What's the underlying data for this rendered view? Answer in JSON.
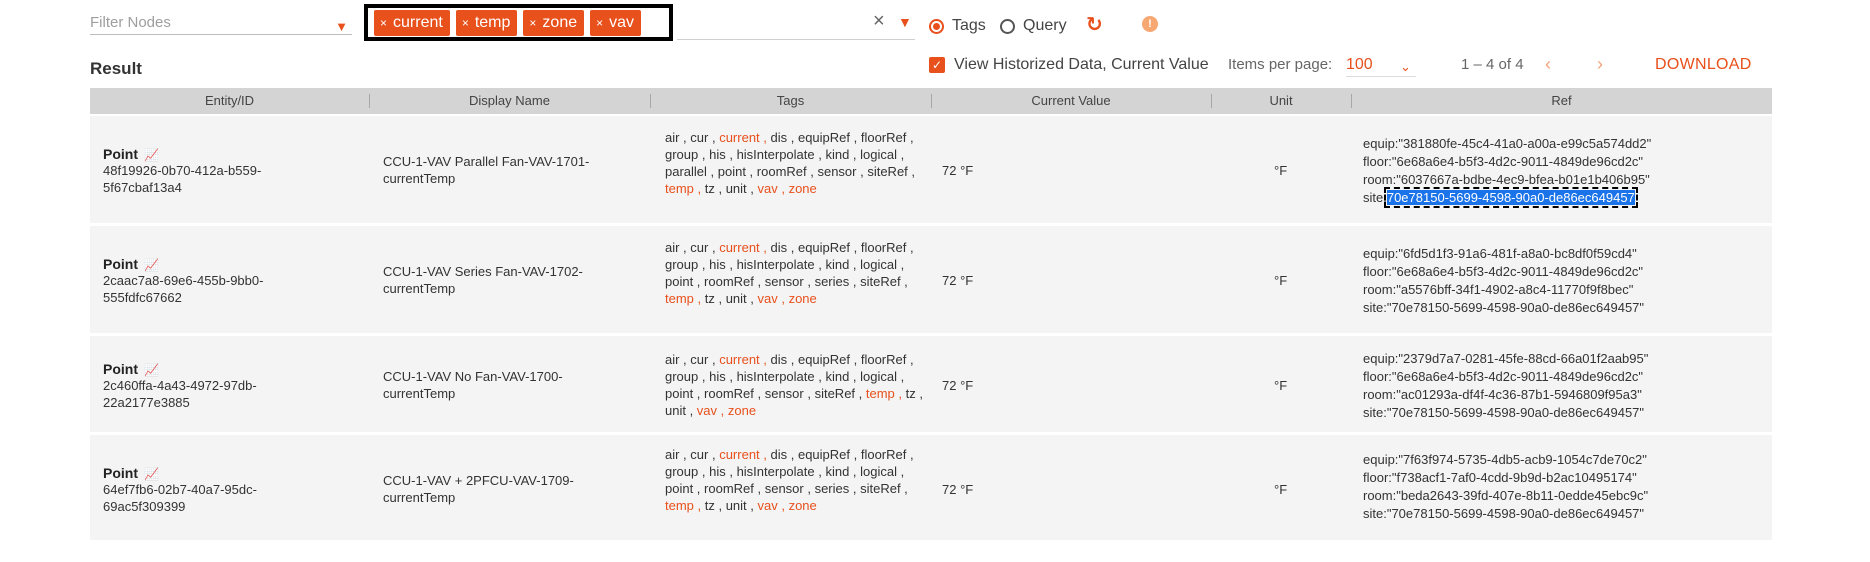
{
  "filter": {
    "placeholder": "Filter Nodes"
  },
  "tag_chips": [
    "current",
    "temp",
    "zone",
    "vav"
  ],
  "chip_remove_glyph": "×",
  "clear_glyph": "×",
  "mode": {
    "tags_label": "Tags",
    "query_label": "Query",
    "selected": "Tags"
  },
  "result_title": "Result",
  "view_historized": {
    "label": "View Historized Data, Current Value",
    "checked": true
  },
  "items_per_page": {
    "label": "Items per page:",
    "value": "100"
  },
  "range_text": "1 – 4 of 4",
  "download_label": "DOWNLOAD",
  "colors": {
    "accent": "#e8501c",
    "header_bg": "#d4d4d4",
    "row_bg": "#f4f4f4",
    "selection": "#1a73e8"
  },
  "table": {
    "columns": [
      "Entity/ID",
      "Display Name",
      "Tags",
      "Current Value",
      "Unit",
      "Ref"
    ],
    "rows": [
      {
        "type": "Point",
        "id_line1": "48f19926-0b70-412a-b559-",
        "id_line2": "5f67cbaf13a4",
        "display_line1": "CCU-1-VAV Parallel Fan-VAV-1701-",
        "display_line2": "currentTemp",
        "tags": [
          "air",
          "cur",
          "current",
          "dis",
          "equipRef",
          "floorRef",
          "group",
          "his",
          "hisInterpolate",
          "kind",
          "logical",
          "parallel",
          "point",
          "roomRef",
          "sensor",
          "siteRef",
          "temp",
          "tz",
          "unit",
          "vav",
          "zone"
        ],
        "current_value": "72 °F",
        "unit": "°F",
        "ref": {
          "equip": "equip:\"381880fe-45c4-41a0-a00a-e99c5a574dd2\"",
          "floor": "floor:\"6e68a6e4-b5f3-4d2c-9011-4849de96cd2c\"",
          "room": "room:\"6037667a-bdbe-4ec9-bfea-b01e1b406b95\"",
          "site_prefix": "site:",
          "site_value": "70e78150-5699-4598-90a0-de86ec649457"
        }
      },
      {
        "type": "Point",
        "id_line1": "2caac7a8-69e6-455b-9bb0-",
        "id_line2": "555fdfc67662",
        "display_line1": "CCU-1-VAV Series Fan-VAV-1702-",
        "display_line2": "currentTemp",
        "tags": [
          "air",
          "cur",
          "current",
          "dis",
          "equipRef",
          "floorRef",
          "group",
          "his",
          "hisInterpolate",
          "kind",
          "logical",
          "point",
          "roomRef",
          "sensor",
          "series",
          "siteRef",
          "temp",
          "tz",
          "unit",
          "vav",
          "zone"
        ],
        "current_value": "72 °F",
        "unit": "°F",
        "ref": {
          "equip": "equip:\"6fd5d1f3-91a6-481f-a8a0-bc8df0f59cd4\"",
          "floor": "floor:\"6e68a6e4-b5f3-4d2c-9011-4849de96cd2c\"",
          "room": "room:\"a5576bff-34f1-4902-a8c4-11770f9f8bec\"",
          "site": "site:\"70e78150-5699-4598-90a0-de86ec649457\""
        }
      },
      {
        "type": "Point",
        "id_line1": "2c460ffa-4a43-4972-97db-",
        "id_line2": "22a2177e3885",
        "display_line1": "CCU-1-VAV No Fan-VAV-1700-",
        "display_line2": "currentTemp",
        "tags": [
          "air",
          "cur",
          "current",
          "dis",
          "equipRef",
          "floorRef",
          "group",
          "his",
          "hisInterpolate",
          "kind",
          "logical",
          "point",
          "roomRef",
          "sensor",
          "siteRef",
          "temp",
          "tz",
          "unit",
          "vav",
          "zone"
        ],
        "current_value": "72 °F",
        "unit": "°F",
        "ref": {
          "equip": "equip:\"2379d7a7-0281-45fe-88cd-66a01f2aab95\"",
          "floor": "floor:\"6e68a6e4-b5f3-4d2c-9011-4849de96cd2c\"",
          "room": "room:\"ac01293a-df4f-4c36-87b1-5946809f95a3\"",
          "site": "site:\"70e78150-5699-4598-90a0-de86ec649457\""
        }
      },
      {
        "type": "Point",
        "id_line1": "64ef7fb6-02b7-40a7-95dc-",
        "id_line2": "69ac5f309399",
        "display_line1": "CCU-1-VAV + 2PFCU-VAV-1709-",
        "display_line2": "currentTemp",
        "tags": [
          "air",
          "cur",
          "current",
          "dis",
          "equipRef",
          "floorRef",
          "group",
          "his",
          "hisInterpolate",
          "kind",
          "logical",
          "point",
          "roomRef",
          "sensor",
          "series",
          "siteRef",
          "temp",
          "tz",
          "unit",
          "vav",
          "zone"
        ],
        "current_value": "72 °F",
        "unit": "°F",
        "ref": {
          "equip": "equip:\"7f63f974-5735-4db5-acb9-1054c7de70c2\"",
          "floor": "floor:\"f738acf1-7af0-4cdd-9b9d-b2ac10495174\"",
          "room": "room:\"beda2643-39fd-407e-8b11-0edde45ebc9c\"",
          "site": "site:\"70e78150-5699-4598-90a0-de86ec649457\""
        }
      }
    ]
  }
}
